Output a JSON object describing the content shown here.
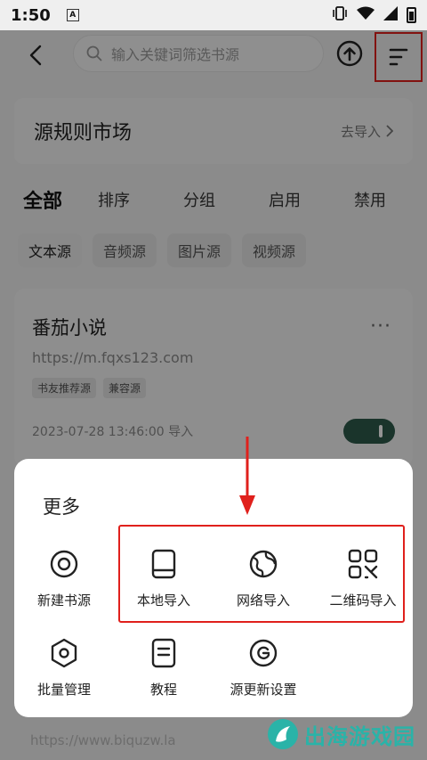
{
  "status_bar": {
    "time": "1:50",
    "notification_glyph": "A"
  },
  "search": {
    "placeholder": "输入关键词筛选书源"
  },
  "market": {
    "title": "源规则市场",
    "link": "去导入"
  },
  "tabs": [
    {
      "label": "全部",
      "active": true
    },
    {
      "label": "排序"
    },
    {
      "label": "分组"
    },
    {
      "label": "启用"
    },
    {
      "label": "禁用"
    }
  ],
  "chips": [
    {
      "label": "文本源",
      "active": true
    },
    {
      "label": "音频源"
    },
    {
      "label": "图片源"
    },
    {
      "label": "视频源"
    }
  ],
  "source": {
    "name": "番茄小说",
    "url": "https://m.fqxs123.com",
    "tags": [
      "书友推荐源",
      "兼容源"
    ],
    "time": "2023-07-28 13:46:00 导入",
    "enabled": true
  },
  "behind_url": "https://www.biquzw.la",
  "sheet": {
    "title": "更多",
    "items": [
      {
        "label": "新建书源",
        "icon": "target-icon"
      },
      {
        "label": "本地导入",
        "icon": "book-icon"
      },
      {
        "label": "网络导入",
        "icon": "globe-icon"
      },
      {
        "label": "二维码导入",
        "icon": "qr-code-icon"
      },
      {
        "label": "批量管理",
        "icon": "hexagon-settings-icon"
      },
      {
        "label": "教程",
        "icon": "document-icon"
      },
      {
        "label": "源更新设置",
        "icon": "refresh-circle-icon"
      }
    ]
  },
  "watermark": {
    "text": "出海游戏园"
  },
  "colors": {
    "accent_green": "#2e5a4a",
    "annotation_red": "#e0201c",
    "watermark_teal": "#2ab3a8"
  }
}
